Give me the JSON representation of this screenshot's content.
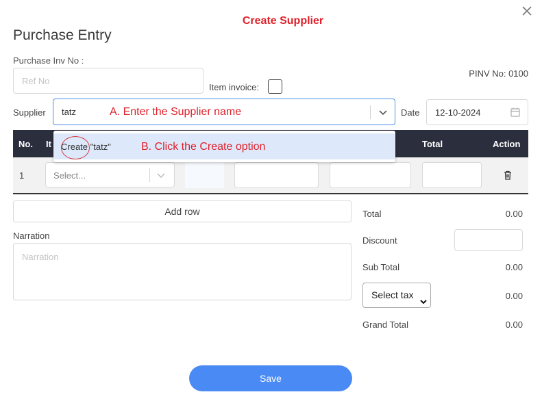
{
  "annotations": {
    "title": "Create Supplier",
    "step_a": "A. Enter the Supplier name",
    "step_b": "B. Click the Create option"
  },
  "header": {
    "title": "Purchase Entry"
  },
  "invoice": {
    "label": "Purchase Inv No :",
    "placeholder": "Ref No",
    "item_invoice_label": "Item invoice:",
    "pinv": "PINV No: 0100"
  },
  "supplier": {
    "label": "Supplier",
    "value": "tatz"
  },
  "date": {
    "label": "Date",
    "value": "12-10-2024"
  },
  "dropdown": {
    "create_word": "Create",
    "option_rest": " \"tatz\""
  },
  "table": {
    "columns": {
      "no": "No.",
      "item": "It",
      "total": "Total",
      "action": "Action"
    },
    "rows": [
      {
        "no": "1",
        "item_placeholder": "Select..."
      }
    ]
  },
  "buttons": {
    "add_row": "Add row",
    "save": "Save"
  },
  "narration": {
    "label": "Narration",
    "placeholder": "Narration"
  },
  "summary": {
    "total_label": "Total",
    "total_value": "0.00",
    "discount_label": "Discount",
    "subtotal_label": "Sub Total",
    "subtotal_value": "0.00",
    "tax_select": "Select tax",
    "tax_value": "0.00",
    "grand_label": "Grand Total",
    "grand_value": "0.00"
  },
  "colors": {
    "accent": "#4a8af4",
    "annotation": "#e0202a",
    "table_header": "#2b2e3d",
    "option_highlight": "#dde9fb"
  }
}
